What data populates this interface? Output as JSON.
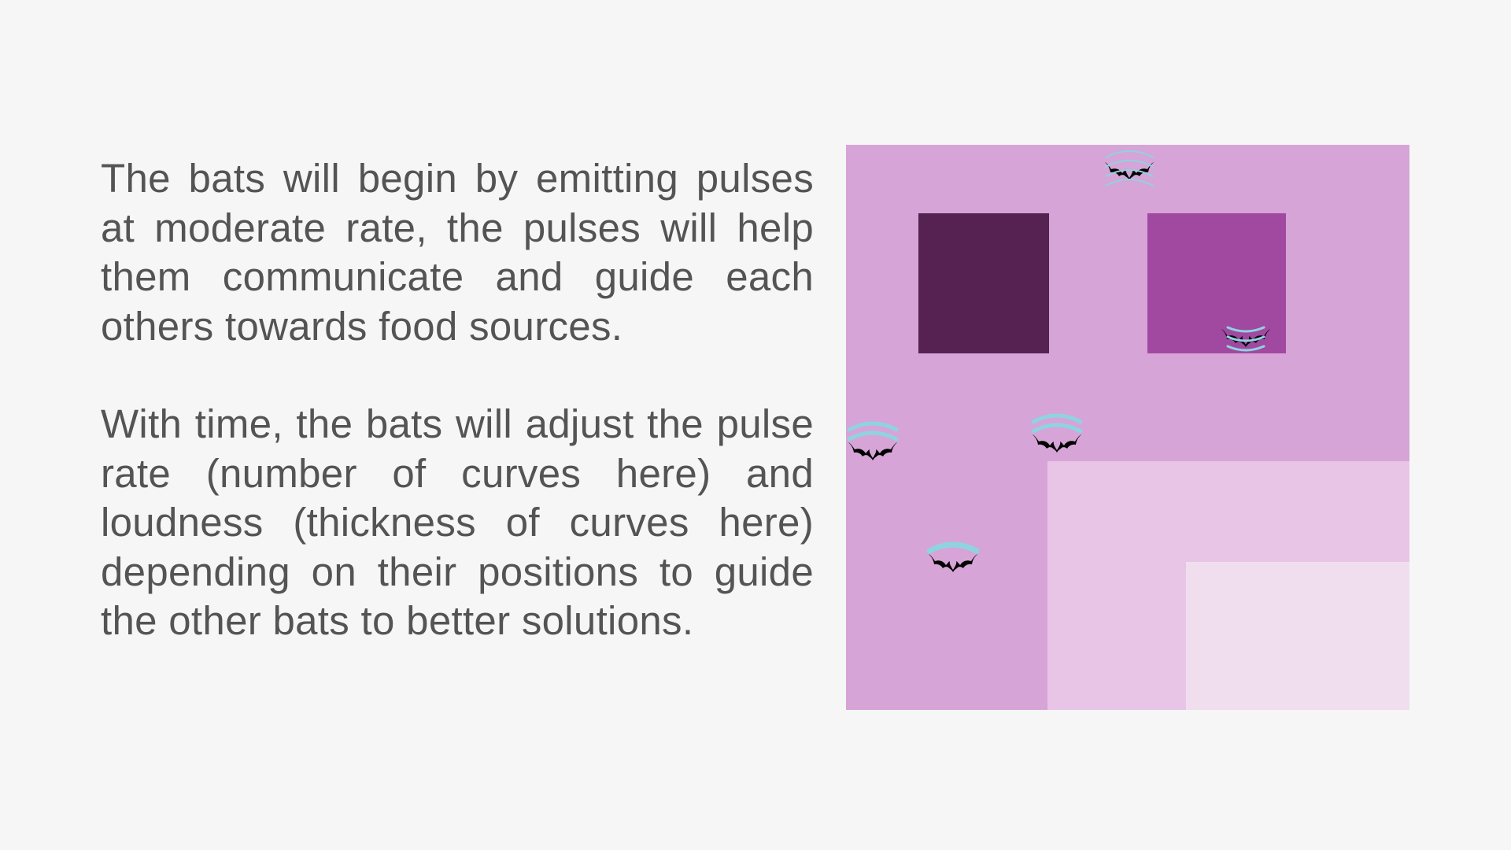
{
  "slide": {
    "paragraphs": [
      "The bats will begin by emitting pulses at moderate rate, the pulses will help them communicate and guide each others towards food sources.",
      "With time, the bats will adjust the pulse rate (number of curves here) and loudness (thickness of curves here) depending on their positions to guide the other bats to better solutions."
    ]
  },
  "diagram": {
    "colors": {
      "background_region": "#d6a4d6",
      "mid_region": "#e8c5e6",
      "light_region": "#f0deef",
      "dark_square": "#552252",
      "medium_square": "#a149a1",
      "pulse_curve": "#8fd3e0",
      "bat": "#000000"
    },
    "bats": [
      {
        "icon": "bat-icon",
        "pulse_curves": 3,
        "loudness": "thin"
      },
      {
        "icon": "bat-icon",
        "pulse_curves": 4,
        "loudness": "very-thin"
      },
      {
        "icon": "bat-icon",
        "pulse_curves": 2,
        "loudness": "medium"
      },
      {
        "icon": "bat-icon",
        "pulse_curves": 2,
        "loudness": "medium"
      },
      {
        "icon": "bat-icon",
        "pulse_curves": 1,
        "loudness": "thick"
      }
    ]
  }
}
